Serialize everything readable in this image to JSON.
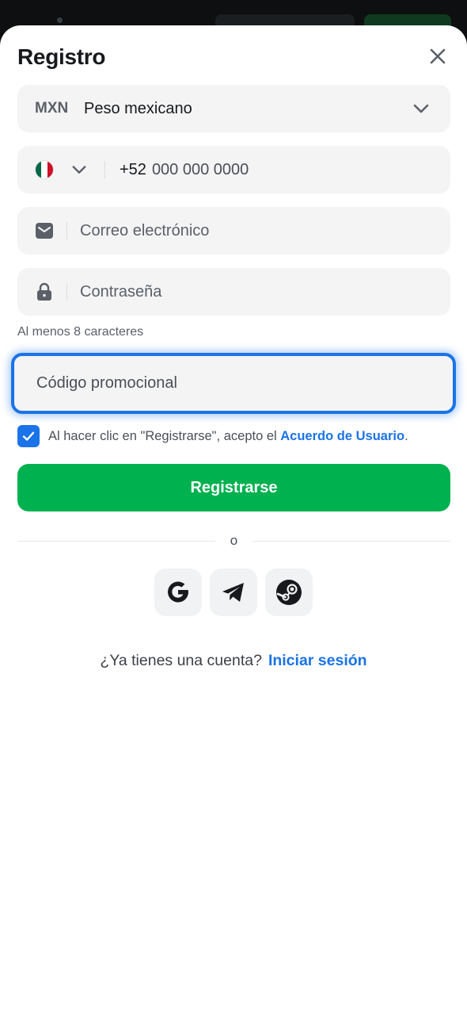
{
  "title": "Registro",
  "currency": {
    "code": "MXN",
    "name": "Peso mexicano"
  },
  "phone": {
    "prefix": "+52",
    "placeholder": "000 000 0000",
    "flag_colors": [
      "#006847",
      "#ffffff",
      "#ce1126"
    ]
  },
  "email": {
    "placeholder": "Correo electrónico"
  },
  "password": {
    "placeholder": "Contraseña",
    "hint": "Al menos 8 caracteres"
  },
  "promo": {
    "placeholder": "Código promocional"
  },
  "terms": {
    "text": "Al hacer clic en \"Registrarse\", acepto el ",
    "link": "Acuerdo de Usuario",
    "suffix": ".",
    "checked": true
  },
  "register_label": "Registrarse",
  "divider_text": "o",
  "socials": [
    "google-icon",
    "telegram-icon",
    "steam-icon"
  ],
  "login": {
    "question": "¿Ya tienes una cuenta?",
    "link": "Iniciar sesión"
  },
  "colors": {
    "accent": "#1a73e8",
    "primary_button": "#00b14f",
    "field_bg": "#f4f4f5"
  }
}
